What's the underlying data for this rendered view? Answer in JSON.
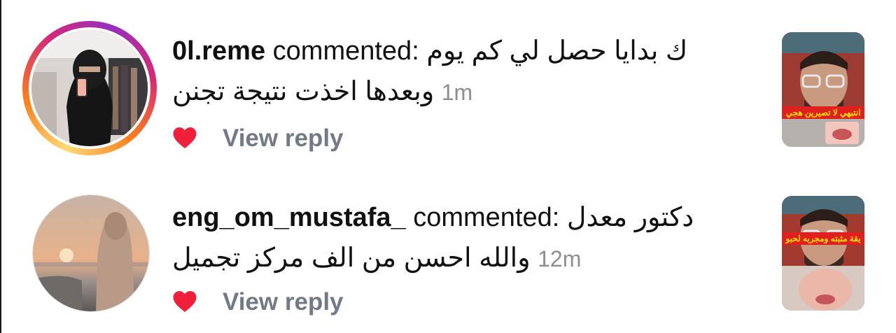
{
  "notifications": [
    {
      "username": "0l.reme",
      "verb": "commented:",
      "comment_line1": "ك بدايا حصل لي كم يوم",
      "comment_line2": "وبعدها اخذت نتيجة تجنن",
      "time": "1m",
      "view_reply": "View reply",
      "has_story_ring": true,
      "liked": true,
      "thumbnail_caption": "انتبهي لا تصيرين هجي"
    },
    {
      "username": "eng_om_mustafa_",
      "verb": "commented:",
      "comment_line1": "دكتور معدل",
      "comment_line2": "والله احسن من الف مركز تجميل",
      "time": "12m",
      "view_reply": "View reply",
      "has_story_ring": false,
      "liked": true,
      "thumbnail_caption": "يقة مثبته ومجربه لحبو"
    }
  ],
  "colors": {
    "heart": "#f0203a",
    "muted_text": "#8e8e8e",
    "view_reply": "#737a87",
    "caption_bg": "#e0201e",
    "caption_text": "#ffe000"
  },
  "icons": {
    "like": "heart-icon"
  }
}
